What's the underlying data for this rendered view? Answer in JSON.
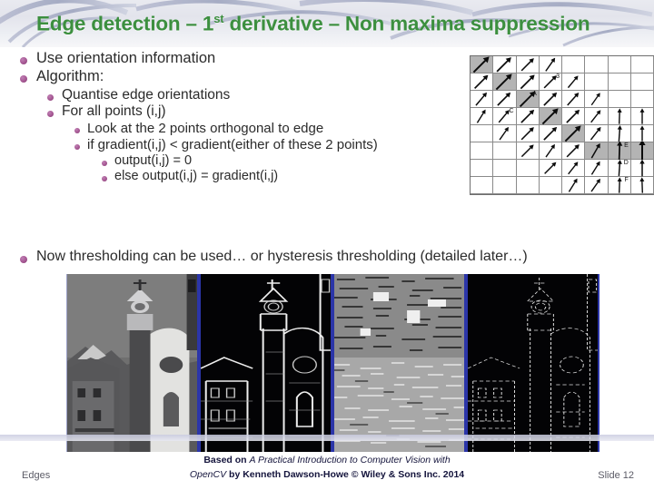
{
  "slide": {
    "title_prefix": "Edge detection – 1",
    "title_sup": "st",
    "title_suffix": " derivative – Non maxima suppression",
    "title_color": "#3c8f3f",
    "bullet_color": "#a2538f"
  },
  "bullets": [
    {
      "level": 1,
      "text": "Use orientation information"
    },
    {
      "level": 1,
      "text": "Algorithm:"
    },
    {
      "level": 2,
      "text": "Quantise edge orientations"
    },
    {
      "level": 2,
      "text": "For all points (i,j)"
    },
    {
      "level": 3,
      "text": "Look at the 2 points orthogonal to edge"
    },
    {
      "level": 3,
      "text": "if  gradient(i,j) < gradient(either of these 2 points)"
    },
    {
      "level": 4,
      "text": "output(i,j) = 0"
    },
    {
      "level": 4,
      "text": "else output(i,j) = gradient(i,j)"
    }
  ],
  "final_bullet": {
    "level": 1,
    "text": "Now thresholding can be used… or hysteresis thresholding (detailed later…)"
  },
  "orientation_grid": {
    "name": "gradient-orientation-grid",
    "columns": 8,
    "rows": 8,
    "shade_color": "#b4b4b4",
    "cells": [
      [
        {
          "a": 45,
          "s": true,
          "w": 2.0
        },
        {
          "a": 45,
          "s": false,
          "w": 1.6
        },
        {
          "a": 45,
          "s": false,
          "w": 1.2
        },
        {
          "a": 55,
          "s": false,
          "w": 1.0
        },
        null,
        null,
        null,
        null
      ],
      [
        {
          "a": 45,
          "s": false,
          "w": 1.4
        },
        {
          "a": 45,
          "s": true,
          "w": 1.9
        },
        {
          "a": 45,
          "s": false,
          "w": 1.5
        },
        {
          "a": 45,
          "s": false,
          "w": 1.2,
          "label": "3"
        },
        {
          "a": 50,
          "s": false,
          "w": 0.9
        },
        null,
        null,
        null
      ],
      [
        {
          "a": 50,
          "s": false,
          "w": 1.1
        },
        {
          "a": 45,
          "s": false,
          "w": 1.3
        },
        {
          "a": 45,
          "s": true,
          "w": 1.8,
          "label": "A"
        },
        {
          "a": 45,
          "s": false,
          "w": 1.3
        },
        {
          "a": 48,
          "s": false,
          "w": 1.1
        },
        {
          "a": 55,
          "s": false,
          "w": 0.8
        },
        null,
        null
      ],
      [
        {
          "a": 58,
          "s": false,
          "w": 0.9
        },
        {
          "a": 50,
          "s": false,
          "w": 1.0,
          "label": "C"
        },
        {
          "a": 45,
          "s": false,
          "w": 1.3
        },
        {
          "a": 45,
          "s": true,
          "w": 1.9
        },
        {
          "a": 45,
          "s": false,
          "w": 1.3
        },
        {
          "a": 52,
          "s": false,
          "w": 0.9
        },
        {
          "a": 88,
          "s": false,
          "w": 0.9
        },
        {
          "a": 90,
          "s": false,
          "w": 0.9
        }
      ],
      [
        null,
        {
          "a": 55,
          "s": false,
          "w": 0.9
        },
        {
          "a": 45,
          "s": false,
          "w": 1.2
        },
        {
          "a": 45,
          "s": false,
          "w": 1.3
        },
        {
          "a": 45,
          "s": true,
          "w": 1.9
        },
        {
          "a": 52,
          "s": false,
          "w": 1.0
        },
        {
          "a": 86,
          "s": false,
          "w": 1.0
        },
        {
          "a": 90,
          "s": false,
          "w": 0.9
        }
      ],
      [
        null,
        null,
        {
          "a": 45,
          "s": false,
          "w": 1.1
        },
        {
          "a": 55,
          "s": false,
          "w": 0.9
        },
        {
          "a": 45,
          "s": false,
          "w": 1.2
        },
        {
          "a": 60,
          "s": true,
          "w": 1.1
        },
        {
          "a": 88,
          "s": true,
          "w": 1.5,
          "label": "E"
        },
        {
          "a": 90,
          "s": true,
          "w": 2.0
        },
        {
          "a": 90,
          "s": true,
          "w": 1.2
        }
      ],
      [
        null,
        null,
        null,
        {
          "a": 45,
          "s": false,
          "w": 1.0
        },
        {
          "a": 52,
          "s": false,
          "w": 0.9
        },
        {
          "a": 58,
          "s": false,
          "w": 0.9
        },
        {
          "a": 86,
          "s": false,
          "w": 1.0,
          "label": "D"
        },
        {
          "a": 90,
          "s": false,
          "w": 1.1
        },
        {
          "a": 90,
          "s": false,
          "w": 0.9
        }
      ],
      [
        null,
        null,
        null,
        null,
        {
          "a": 58,
          "s": false,
          "w": 0.9
        },
        {
          "a": 55,
          "s": false,
          "w": 0.9
        },
        {
          "a": 88,
          "s": false,
          "w": 0.9,
          "label": "F"
        },
        {
          "a": 92,
          "s": false,
          "w": 0.9
        },
        {
          "a": 90,
          "s": false,
          "w": 0.9
        }
      ]
    ]
  },
  "image_strip": {
    "panels": [
      {
        "name": "original-greyscale-image",
        "caption": ""
      },
      {
        "name": "gradient-magnitude-image",
        "caption": ""
      },
      {
        "name": "quantised-orientation-image",
        "caption": ""
      },
      {
        "name": "non-maxima-suppressed-image",
        "caption": ""
      }
    ]
  },
  "footer": {
    "left": "Edges",
    "center_line1_bold": "Based on ",
    "center_line1_italic": "A Practical Introduction to Computer Vision with",
    "center_line2_italic": "OpenCV",
    "center_line2_bold": " by Kenneth Dawson-Howe © Wiley & Sons Inc. 2014",
    "right": "Slide 12"
  }
}
